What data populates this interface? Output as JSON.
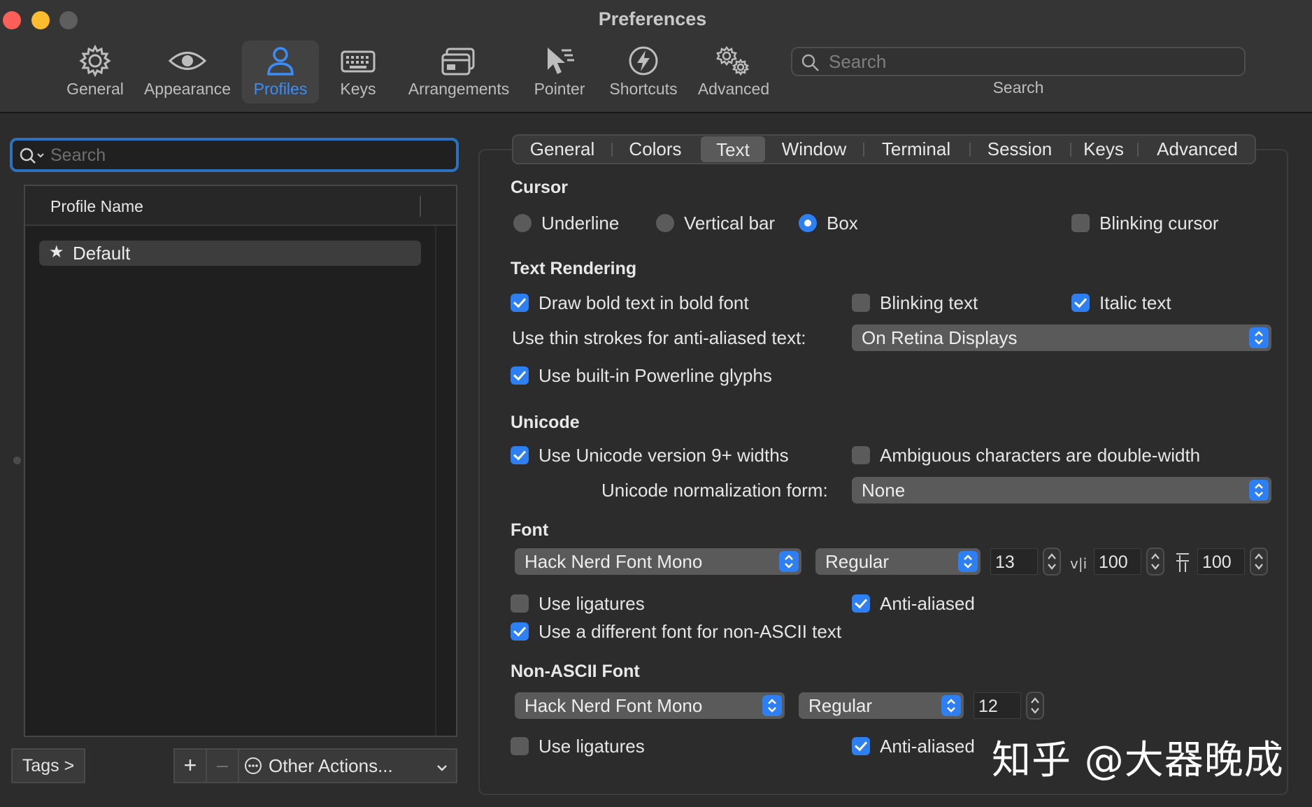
{
  "window": {
    "title": "Preferences"
  },
  "toolbar": {
    "items": [
      {
        "label": "General",
        "icon": "gear-icon"
      },
      {
        "label": "Appearance",
        "icon": "eye-icon"
      },
      {
        "label": "Profiles",
        "icon": "person-icon",
        "selected": true
      },
      {
        "label": "Keys",
        "icon": "keyboard-icon"
      },
      {
        "label": "Arrangements",
        "icon": "windows-icon"
      },
      {
        "label": "Pointer",
        "icon": "pointer-icon"
      },
      {
        "label": "Shortcuts",
        "icon": "bolt-icon"
      },
      {
        "label": "Advanced",
        "icon": "gears-icon"
      }
    ],
    "search": {
      "placeholder": "Search",
      "caption": "Search"
    }
  },
  "profiles": {
    "search_placeholder": "Search",
    "column_header": "Profile Name",
    "rows": [
      {
        "name": "Default",
        "icon": "star-icon"
      }
    ],
    "tags_label": "Tags >",
    "add_label": "+",
    "remove_label": "–",
    "other_actions_label": "Other Actions..."
  },
  "tabs": [
    {
      "label": "General"
    },
    {
      "label": "Colors"
    },
    {
      "label": "Text",
      "selected": true
    },
    {
      "label": "Window"
    },
    {
      "label": "Terminal"
    },
    {
      "label": "Session"
    },
    {
      "label": "Keys"
    },
    {
      "label": "Advanced"
    }
  ],
  "cursor": {
    "heading": "Cursor",
    "options": [
      {
        "label": "Underline",
        "selected": false
      },
      {
        "label": "Vertical bar",
        "selected": false
      },
      {
        "label": "Box",
        "selected": true
      }
    ],
    "blinking_cursor": {
      "label": "Blinking cursor",
      "checked": false
    }
  },
  "text_rendering": {
    "heading": "Text Rendering",
    "bold": {
      "label": "Draw bold text in bold font",
      "checked": true
    },
    "blinking": {
      "label": "Blinking text",
      "checked": false
    },
    "italic": {
      "label": "Italic text",
      "checked": true
    },
    "thin_strokes_label": "Use thin strokes for anti-aliased text:",
    "thin_strokes_value": "On Retina Displays",
    "powerline": {
      "label": "Use built-in Powerline glyphs",
      "checked": true
    }
  },
  "unicode": {
    "heading": "Unicode",
    "v9_widths": {
      "label": "Use Unicode version 9+ widths",
      "checked": true
    },
    "ambiguous": {
      "label": "Ambiguous characters are double-width",
      "checked": false
    },
    "normalization_label": "Unicode normalization form:",
    "normalization_value": "None"
  },
  "font": {
    "heading": "Font",
    "family": "Hack Nerd Font Mono",
    "weight": "Regular",
    "size": "13",
    "horizontal_spacing": "100",
    "vertical_spacing": "100",
    "ligatures": {
      "label": "Use ligatures",
      "checked": false
    },
    "anti_aliased": {
      "label": "Anti-aliased",
      "checked": true
    },
    "non_ascii_toggle": {
      "label": "Use a different font for non-ASCII text",
      "checked": true
    }
  },
  "non_ascii_font": {
    "heading": "Non-ASCII Font",
    "family": "Hack Nerd Font Mono",
    "weight": "Regular",
    "size": "12",
    "ligatures": {
      "label": "Use ligatures",
      "checked": false
    },
    "anti_aliased": {
      "label": "Anti-aliased",
      "checked": true
    }
  },
  "watermark": {
    "text": "知乎 @大器晚成"
  },
  "colors": {
    "accent": "#2e7ff2",
    "selected_toolbar": "#3b8df7",
    "close": "#fe5f57",
    "minimize": "#febc2e"
  }
}
